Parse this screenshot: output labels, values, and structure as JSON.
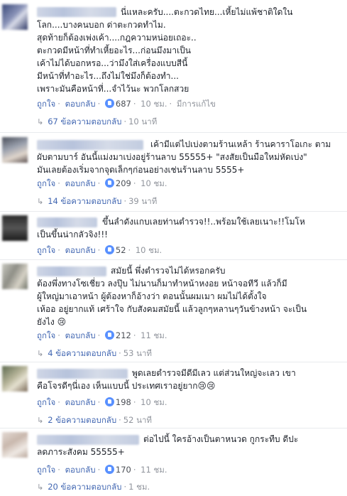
{
  "labels": {
    "like": "ถูกใจ",
    "reply": "ตอบกลับ",
    "edited": "มีการแก้ไข",
    "sep": "·"
  },
  "comments": [
    {
      "text": "นี่แหละครับ....ตะกวดไทย...เหี้ยไม่แพ้ชาติใดใน\nโลก....บางคนบอก ด่าตะกวดทำไม.\nสุดท้ายก็ต้องเพ่งเค้า....กฎความหน่อยเถอะ..\nตะกวดมีหน้าที่ทำเหี้ยอะไร...ก่อนมึงมาเป็น\nเค้าไม่ได้บอกหรอ...ว่ามึงใส่เครื่องแบบสีนี้\nมีหน้าที่ทำอะไร...ถึงไม่ใช่มึงก็ต้องทำ...\nเพราะมันคือหน้าที่...จำไว้นะ พวกโลกสวย",
      "likes": "687",
      "time": "10 ชม.",
      "edited": true,
      "replies_label": "67 ข้อความตอบกลับ",
      "replies_time": "10 นาที"
    },
    {
      "text": "เค้ามีแต่ไปเบ่งตามร้านเหล้า ร้านคาราโอเกะ ตาม\nผับตามบาร์ อันนี้แม่งมาเบ่งอยู่ร้านลาบ 55555+ \"สงสัยเป็นมือใหม่หัดเบ่ง\"\nมันเลยต้องเริ่มจากจุดเล็กๆก่อนอย่างเช่นร้านลาบ 5555+",
      "likes": "209",
      "time": "10 ชม.",
      "replies_label": "14 ข้อความตอบกลับ",
      "replies_time": "39 นาที"
    },
    {
      "text": "ขึ้นลำดังแกบเลยท่านตำรวจ!!..พร้อมใช้เลยเนาะ!!โมโห\nเป็นขึ้นน่ากลัวจิง!!!",
      "likes": "52",
      "time": "10 ชม."
    },
    {
      "text": "สมัยนี้ พึ่งตำรวจไม่ได้หรอกครับ\nต้องพึ่งทางโซเชี่ยว ลงปุ๊บ ไม่นานก็มาทำหน้าหงอย หน้าจอทีวี แล้วก็มี\nผู้ใหญ่มาเอาหน้า ผู้ต้องหาก็อ้างว่า ตอนนั้นผมเมา ผมไม่ได้ตั้งใจ\nเห้ออ อยู่ยากแท้ เศร้าใจ กับสังคมสมัยนี้ แล้วลูกๆหลานๆวันข้างหน้า จะเป็น\nยังไง 😢",
      "likes": "212",
      "time": "11 ชม.",
      "replies_label": "4 ข้อความตอบกลับ",
      "replies_time": "53 นาที"
    },
    {
      "text": "พูดเลยตำรวจมีดีมีเลว แต่ส่วนใหญ่จะเลว เขา\nคือโจรดีๆนี่เอง เห็นแบบนี้ ประเทศเราอยู่ยาก😢😢",
      "likes": "198",
      "time": "10 ชม.",
      "replies_label": "2 ข้อความตอบกลับ",
      "replies_time": "52 นาที"
    },
    {
      "text": "ต่อไปนี้ ใครอ้างเป็นตาหนวด กูกระทืบ ดีปะ\nลดภาระสังคม 55555+",
      "likes": "170",
      "time": "11 ชม.",
      "replies_label": "20 ข้อความตอบกลับ",
      "replies_time": "1 ชม."
    }
  ]
}
